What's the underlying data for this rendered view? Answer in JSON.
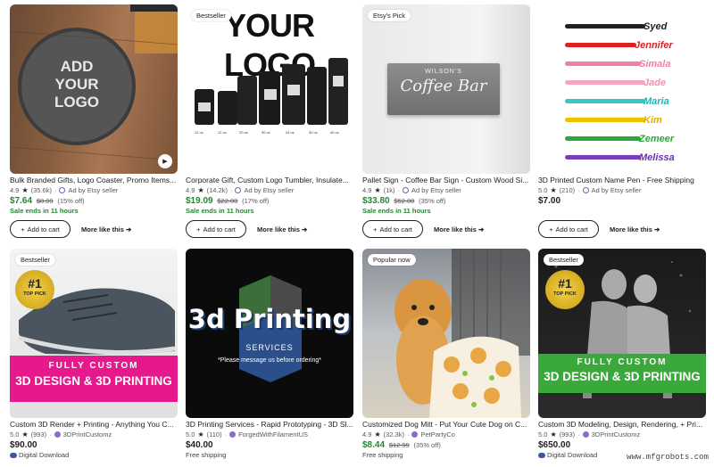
{
  "common": {
    "add_to_cart": "Add to cart",
    "more_like_this": "More like this",
    "add_icon": "plus-icon",
    "arrow_icon": "arrow-right-icon"
  },
  "row1": [
    {
      "title": "Bulk Branded Gifts, Logo Coaster, Promo Items...",
      "rating": "4.9",
      "reviews": "(35.6k)",
      "seller": "Ad by Etsy seller",
      "price": "$7.64",
      "orig_price": "$8.99",
      "discount": "(15% off)",
      "sale_note": "Sale ends in 11 hours",
      "image_text": [
        "ADD",
        "YOUR",
        "LOGO"
      ]
    },
    {
      "title": "Corporate Gift, Custom Logo Tumbler, Insulate...",
      "rating": "4.9",
      "reviews": "(14.2k)",
      "seller": "Ad by Etsy seller",
      "price": "$19.09",
      "orig_price": "$22.00",
      "discount": "(17% off)",
      "sale_note": "Sale ends in 11 hours",
      "badge": "Bestseller",
      "image_text": "YOUR LOGO"
    },
    {
      "title": "Pallet Sign - Coffee Bar Sign - Custom Wood Si...",
      "rating": "4.9",
      "reviews": "(1k)",
      "seller": "Ad by Etsy seller",
      "price": "$33.80",
      "orig_price": "$52.00",
      "discount": "(35% off)",
      "sale_note": "Sale ends in 11 hours",
      "badge": "Etsy's Pick",
      "image_text": [
        "WILSON'S",
        "Coffee Bar"
      ]
    },
    {
      "title": "3D Printed Custom Name Pen - Free Shipping",
      "rating": "5.0",
      "reviews": "(210)",
      "seller": "Ad by Etsy seller",
      "price": "$7.00",
      "pen_names": [
        "Syed",
        "Jennifer",
        "Simala",
        "Jade",
        "Maria",
        "Kim",
        "Zemeer",
        "Melissa"
      ]
    }
  ],
  "row2": [
    {
      "title": "Custom 3D Render + Printing - Anything You C...",
      "rating": "5.0",
      "reviews": "(993)",
      "shop": "3DPrintCustomz",
      "price": "$90.00",
      "footer": "Digital Download",
      "badge": "Bestseller",
      "image_text": [
        "FULLY CUSTOM",
        "3D DESIGN & 3D PRINTING"
      ],
      "seal_text": [
        "#1",
        "TOP PICK"
      ]
    },
    {
      "title": "3D Printing Services - Rapid Prototyping - 3D Sl...",
      "rating": "5.0",
      "reviews": "(110)",
      "shop": "ForgedWithFilamentUS",
      "price": "$40.00",
      "footer": "Free shipping",
      "image_text": [
        "3d Printing",
        "SERVICES",
        "*Please message us before ordering*"
      ]
    },
    {
      "title": "Customized Dog Mitt - Put Your Cute Dog on C...",
      "rating": "4.9",
      "reviews": "(32.3k)",
      "shop": "PetPartyCo",
      "price": "$8.44",
      "orig_price": "$12.99",
      "discount": "(35% off)",
      "footer": "Free shipping",
      "badge": "Popular now"
    },
    {
      "title": "Custom 3D Modeling, Design, Rendering, + Pri...",
      "rating": "5.0",
      "reviews": "(993)",
      "shop": "3DPrintCustomz",
      "price": "$650.00",
      "footer": "Digital Download",
      "badge": "Bestseller",
      "image_text": [
        "FULLY CUSTOM",
        "3D DESIGN & 3D PRINTING"
      ],
      "seal_text": [
        "#1",
        "TOP PICK"
      ]
    }
  ],
  "watermark": "www.mfgrobots.com",
  "colors": {
    "sale_green": "#258635",
    "pink_banner": "#e6198c",
    "green_banner": "#3aa83a",
    "accent_purple": "#7a5ea8"
  }
}
